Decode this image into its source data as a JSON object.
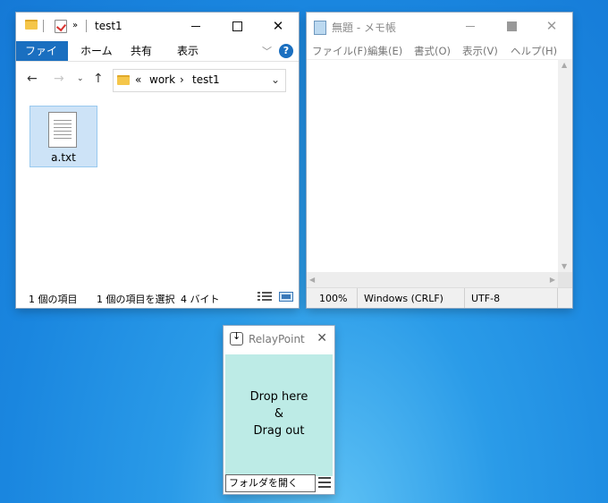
{
  "explorer": {
    "title": "test1",
    "quick_access_more": "»",
    "ribbon_tabs": [
      "ファイル",
      "ホーム",
      "共有",
      "表示"
    ],
    "help": "?",
    "address": {
      "prefix": "«",
      "crumb1": "work",
      "sep": "›",
      "crumb2": "test1"
    },
    "file": {
      "name": "a.txt"
    },
    "status": {
      "count": "1 個の項目",
      "selected": "1 個の項目を選択",
      "size": "4 バイト"
    }
  },
  "notepad": {
    "title": "無題 - メモ帳",
    "menu": [
      "ファイル(F)",
      "編集(E)",
      "書式(O)",
      "表示(V)",
      "ヘルプ(H)"
    ],
    "status": {
      "zoom": "100%",
      "line_ending": "Windows (CRLF)",
      "encoding": "UTF-8"
    }
  },
  "relay": {
    "title": "RelayPoint",
    "drop_line1": "Drop here",
    "drop_line2": "&",
    "drop_line3": "Drag out",
    "open_folder": "フォルダを開く"
  },
  "colors": {
    "accent": "#1a6fc0",
    "drop_zone": "#bdebe6",
    "desktop": "#1a86df"
  }
}
